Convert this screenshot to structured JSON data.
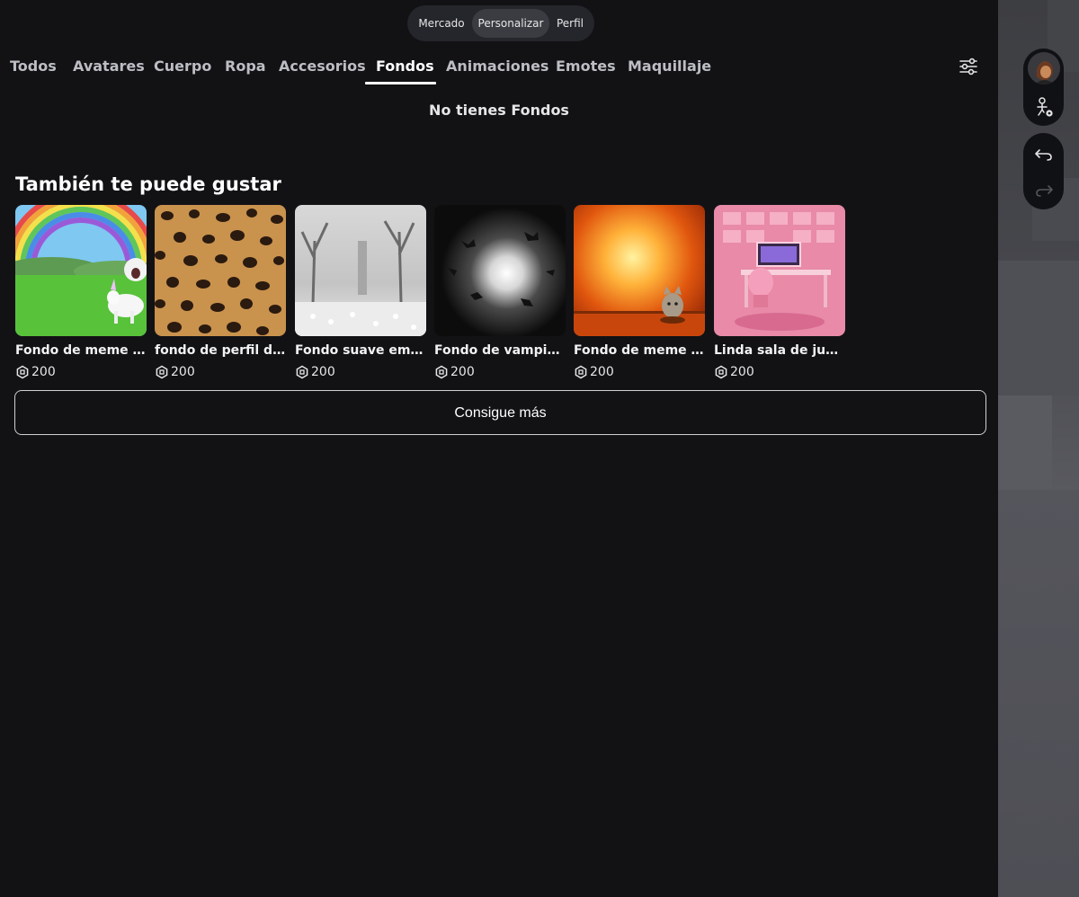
{
  "top_nav": {
    "items": [
      "Mercado",
      "Personalizar",
      "Perfil"
    ],
    "active": "Personalizar"
  },
  "category_tabs": {
    "items": [
      "Todos",
      "Avatares",
      "Cuerpo",
      "Ropa",
      "Accesorios",
      "Fondos",
      "Animaciones",
      "Emotes",
      "Maquillaje"
    ],
    "active": "Fondos"
  },
  "icons": {
    "filter": "sliders-icon",
    "avatar": "avatar-thumbnail",
    "avatar_settings": "avatar-settings-icon",
    "undo": "undo-icon",
    "redo": "redo-icon",
    "currency": "robux-icon"
  },
  "empty_message": "No tienes Fondos",
  "recommendations": {
    "title": "También te puede gustar",
    "items": [
      {
        "name": "Fondo de meme d…",
        "price": "200"
      },
      {
        "name": "fondo de perfil de …",
        "price": "200"
      },
      {
        "name": "Fondo suave emo …",
        "price": "200"
      },
      {
        "name": "Fondo de vampiro …",
        "price": "200"
      },
      {
        "name": "Fondo de meme li…",
        "price": "200"
      },
      {
        "name": "Linda sala de jueg…",
        "price": "200"
      }
    ]
  },
  "get_more_label": "Consigue más",
  "colors": {
    "background": "#121215",
    "segmented_bg": "#25262b",
    "active_segment": "#3b3c42",
    "text_primary": "#ffffff",
    "text_secondary": "#bcbec4"
  }
}
